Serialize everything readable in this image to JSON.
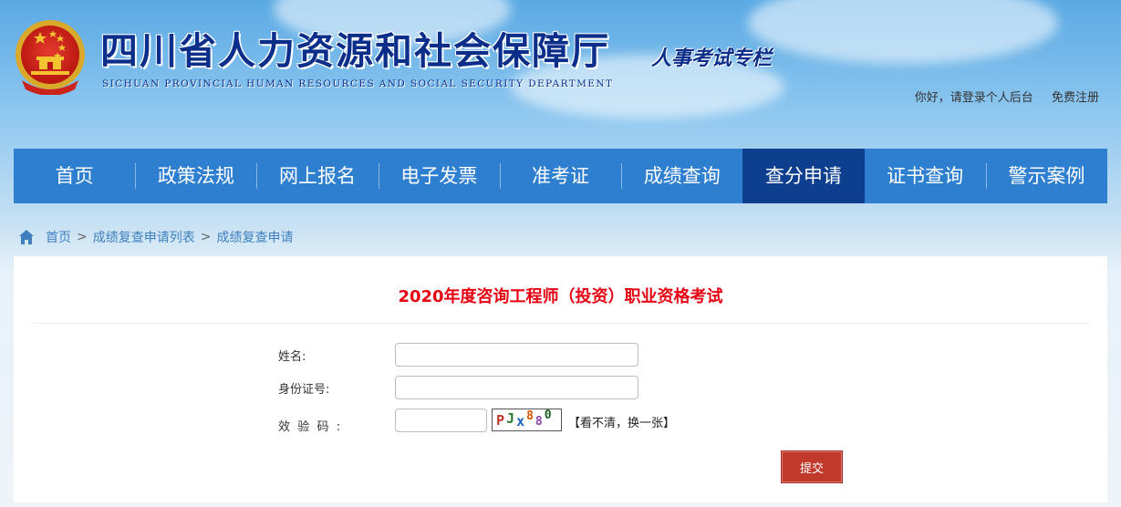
{
  "header": {
    "site_title": "四川省人力资源和社会保障厅",
    "site_subtitle": "SICHUAN PROVINCIAL HUMAN RESOURCES AND SOCIAL SECURITY DEPARTMENT",
    "column_tag": "人事考试专栏",
    "login_link": "你好，请登录个人后台",
    "register_link": "免费注册"
  },
  "nav": {
    "items": [
      {
        "label": "首页"
      },
      {
        "label": "政策法规"
      },
      {
        "label": "网上报名"
      },
      {
        "label": "电子发票"
      },
      {
        "label": "准考证"
      },
      {
        "label": "成绩查询"
      },
      {
        "label": "查分申请"
      },
      {
        "label": "证书查询"
      },
      {
        "label": "警示案例"
      }
    ],
    "active_index": 6
  },
  "breadcrumb": {
    "home": "首页",
    "list": "成绩复查申请列表",
    "current": "成绩复查申请",
    "separator": ">"
  },
  "form": {
    "exam_title": "2020年度咨询工程师（投资）职业资格考试",
    "name_label": "姓名:",
    "name_value": "",
    "id_label": "身份证号:",
    "id_value": "",
    "captcha_label": "效  验  码  :",
    "captcha_value": "",
    "captcha_chars": [
      "P",
      "J",
      "x",
      "8",
      "8",
      "0"
    ],
    "captcha_colors": [
      "#c0392b",
      "#2e7d32",
      "#1565c0",
      "#d35400",
      "#8e44ad",
      "#1b5e20"
    ],
    "refresh_text": "【看不清，换一张】",
    "submit_label": "提交"
  },
  "colors": {
    "nav_bg": "#2f7fd0",
    "nav_active": "#0e3f8e",
    "title_blue": "#0b2e8a",
    "exam_title_red": "#e60012",
    "submit_bg": "#c0392b"
  }
}
